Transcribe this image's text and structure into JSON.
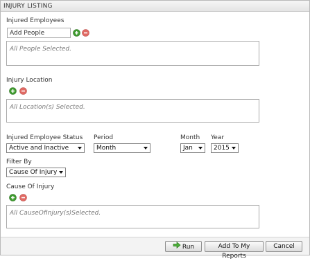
{
  "panel": {
    "title": "INJURY LISTING"
  },
  "injured_employees": {
    "label": "Injured Employees",
    "input_placeholder": "Add People",
    "list_text": "All People Selected."
  },
  "injury_location": {
    "label": "Injury Location",
    "list_text": "All Location(s) Selected."
  },
  "status": {
    "label": "Injured Employee Status",
    "value": "Active and Inactive"
  },
  "period": {
    "label": "Period",
    "value": "Month"
  },
  "month": {
    "label": "Month",
    "value": "Jan"
  },
  "year": {
    "label": "Year",
    "value": "2015"
  },
  "filter_by": {
    "label": "Filter By",
    "value": "Cause Of Injury"
  },
  "cause_of_injury": {
    "label": "Cause Of Injury",
    "list_text": "All CauseOfInjury(s)Selected."
  },
  "buttons": {
    "run": "Run",
    "add_to_reports": "Add To My Reports",
    "cancel": "Cancel"
  },
  "colors": {
    "add": "#3f9b2f",
    "remove": "#d9534f"
  },
  "icons": {
    "add": "plus-circle-icon",
    "remove": "minus-circle-icon",
    "run": "arrow-right-icon"
  }
}
